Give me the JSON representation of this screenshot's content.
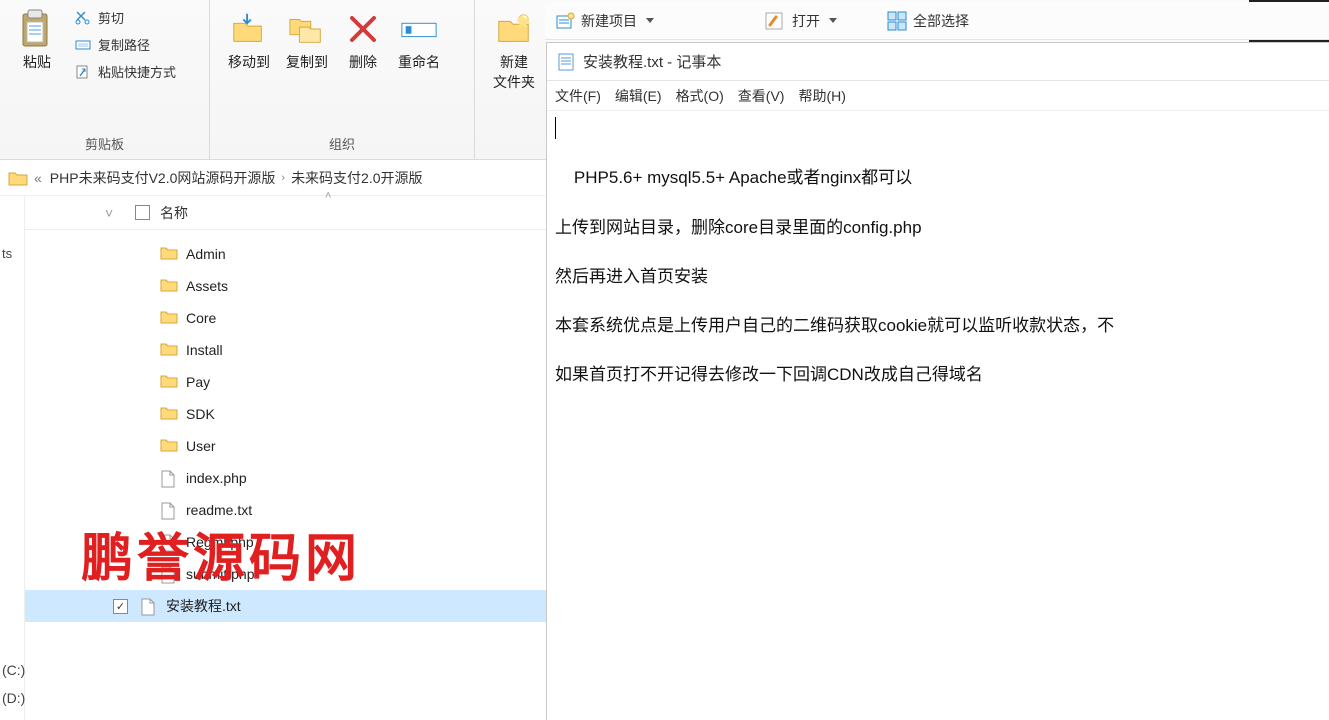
{
  "ribbon": {
    "clipboard": {
      "label": "剪贴板",
      "paste": "粘贴",
      "cut": "剪切",
      "copy_path": "复制路径",
      "paste_shortcut": "粘贴快捷方式"
    },
    "organize": {
      "label": "组织",
      "move_to": "移动到",
      "copy_to": "复制到",
      "delete": "删除",
      "rename": "重命名"
    },
    "new_group": {
      "new": "新建",
      "sub": "文件夹"
    }
  },
  "topbar": {
    "new_project": "新建项目",
    "open": "打开",
    "select_all": "全部选择"
  },
  "breadcrumb": {
    "prev": "«",
    "part1": "PHP未来码支付V2.0网站源码开源版",
    "part2": "未来码支付2.0开源版"
  },
  "columns": {
    "name": "名称"
  },
  "files": [
    {
      "name": "Admin",
      "type": "folder",
      "selected": false
    },
    {
      "name": "Assets",
      "type": "folder",
      "selected": false
    },
    {
      "name": "Core",
      "type": "folder",
      "selected": false
    },
    {
      "name": "Install",
      "type": "folder",
      "selected": false
    },
    {
      "name": "Pay",
      "type": "folder",
      "selected": false
    },
    {
      "name": "SDK",
      "type": "folder",
      "selected": false
    },
    {
      "name": "User",
      "type": "folder",
      "selected": false
    },
    {
      "name": "index.php",
      "type": "file",
      "selected": false
    },
    {
      "name": "readme.txt",
      "type": "file",
      "selected": false
    },
    {
      "name": "Regml.php",
      "type": "file",
      "selected": false
    },
    {
      "name": "submit.php",
      "type": "file",
      "selected": false
    },
    {
      "name": "安装教程.txt",
      "type": "file",
      "selected": true
    }
  ],
  "watermark": "鹏誉源码网",
  "drives": {
    "c": "(C:)",
    "d": "(D:)"
  },
  "sidebar_trunc": "ts",
  "notepad": {
    "title": "安装教程.txt - 记事本",
    "menu": {
      "file": "文件(F)",
      "edit": "编辑(E)",
      "format": "格式(O)",
      "view": "查看(V)",
      "help": "帮助(H)"
    },
    "body": "PHP5.6+ mysql5.5+ Apache或者nginx都可以\n\n上传到网站目录，删除core目录里面的config.php\n\n然后再进入首页安装\n\n本套系统优点是上传用户自己的二维码获取cookie就可以监听收款状态，不\n\n如果首页打不开记得去修改一下回调CDN改成自己得域名"
  }
}
